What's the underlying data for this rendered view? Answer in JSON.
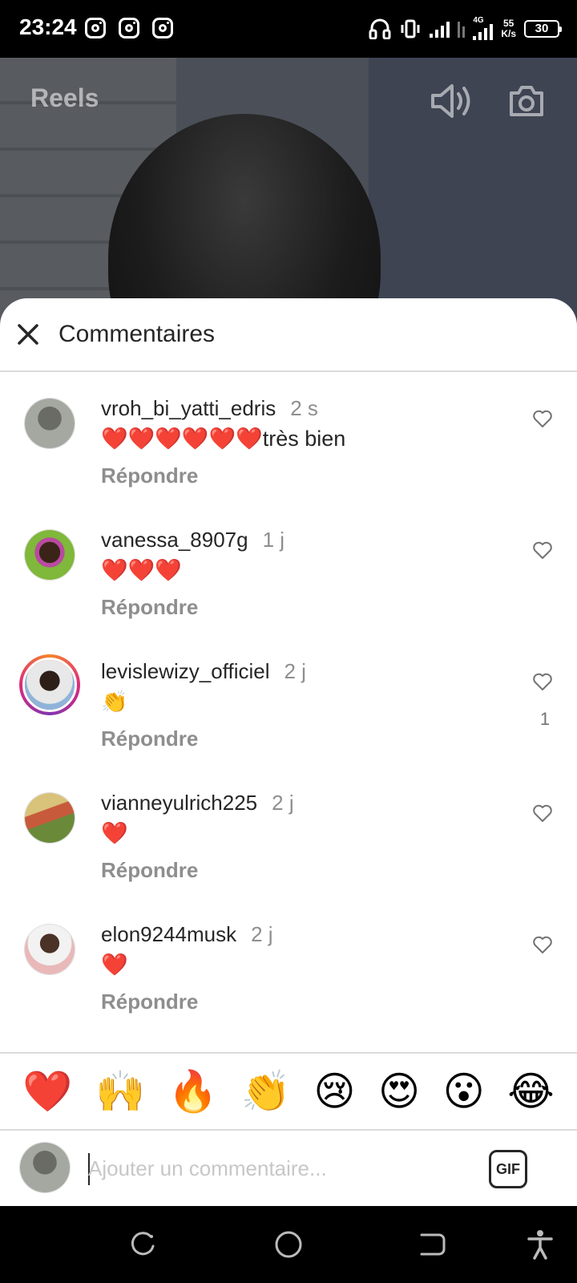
{
  "status_bar": {
    "time": "23:24",
    "network": "4G",
    "speed_value": "55",
    "speed_unit": "K/s",
    "battery": "30"
  },
  "header": {
    "title": "Reels"
  },
  "comments_sheet": {
    "title": "Commentaires",
    "comments": [
      {
        "username": "vroh_bi_yatti_edris",
        "time": "2 s",
        "text": "❤️❤️❤️❤️❤️❤️très bien",
        "reply": "Répondre",
        "likes": ""
      },
      {
        "username": "vanessa_8907g",
        "time": "1 j",
        "text": "❤️❤️❤️",
        "reply": "Répondre",
        "likes": ""
      },
      {
        "username": "levislewizy_officiel",
        "time": "2 j",
        "text": "👏",
        "reply": "Répondre",
        "likes": "1"
      },
      {
        "username": "vianneyulrich225",
        "time": "2 j",
        "text": "❤️",
        "reply": "Répondre",
        "likes": ""
      },
      {
        "username": "elon9244musk",
        "time": "2 j",
        "text": "❤️",
        "reply": "Répondre",
        "likes": ""
      }
    ]
  },
  "emoji_bar": [
    "❤️",
    "🙌",
    "🔥",
    "👏",
    "😢",
    "😍",
    "😮",
    "😂"
  ],
  "input": {
    "placeholder": "Ajouter un commentaire...",
    "gif_label": "GIF"
  },
  "colors": {
    "like_heart": "#262626",
    "secondary_text": "#8e8e8e",
    "story_ring": "#dd2a7b"
  }
}
